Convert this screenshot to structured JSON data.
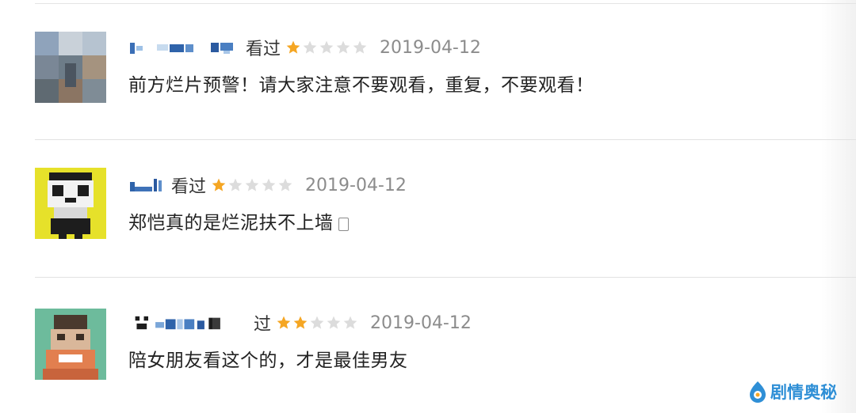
{
  "comments": [
    {
      "watched_label": "看过",
      "rating": 1,
      "max_rating": 5,
      "date": "2019-04-12",
      "text": "前方烂片预警！请大家注意不要观看，重复，不要观看！"
    },
    {
      "watched_label": "看过",
      "rating": 1,
      "max_rating": 5,
      "date": "2019-04-12",
      "text": "郑恺真的是烂泥扶不上墙"
    },
    {
      "watched_label": "过",
      "rating": 2,
      "max_rating": 5,
      "date": "2019-04-12",
      "text": "陪女朋友看这个的，才是最佳男友"
    }
  ],
  "watermark": {
    "text": "剧情奥秘"
  },
  "colors": {
    "star_filled": "#f5a623",
    "star_empty": "#dcdcdc",
    "date": "#8c8c8c",
    "watermark": "#2f8fd6"
  }
}
